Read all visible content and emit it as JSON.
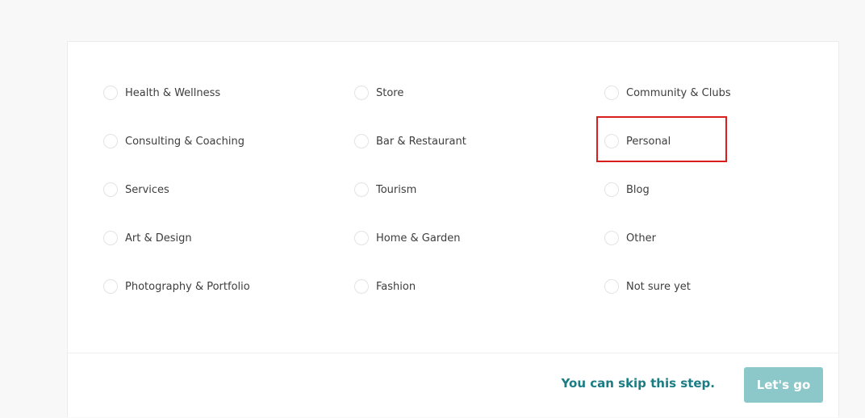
{
  "categories": [
    [
      "Health & Wellness",
      "Store",
      "Community & Clubs"
    ],
    [
      "Consulting & Coaching",
      "Bar & Restaurant",
      "Personal"
    ],
    [
      "Services",
      "Tourism",
      "Blog"
    ],
    [
      "Art & Design",
      "Home & Garden",
      "Other"
    ],
    [
      "Photography & Portfolio",
      "Fashion",
      "Not sure yet"
    ]
  ],
  "highlighted_option": "Personal",
  "footer": {
    "skip_label": "You can skip this step.",
    "go_label": "Let's go"
  },
  "colors": {
    "accent_text": "#1b7d83",
    "button_bg": "#8cc8c9",
    "highlight_border": "#d91e1e"
  }
}
